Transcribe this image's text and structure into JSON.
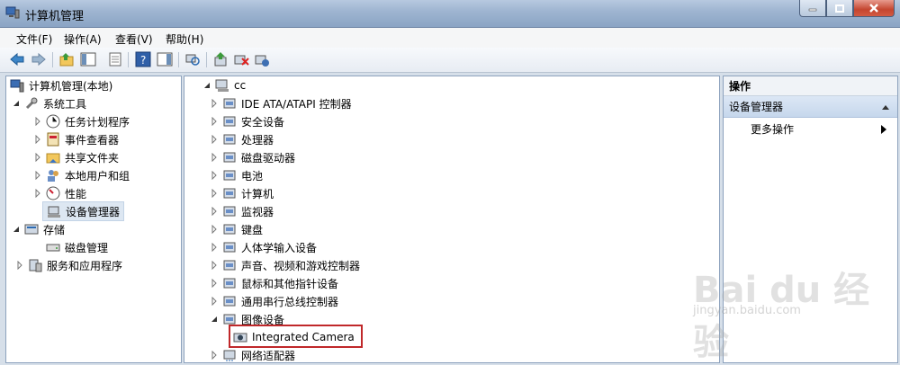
{
  "window": {
    "title": "计算机管理"
  },
  "menu": [
    "文件(F)",
    "操作(A)",
    "查看(V)",
    "帮助(H)"
  ],
  "toolbar_icons": [
    "back-icon",
    "forward-icon",
    "up-folder-icon",
    "show-hide-tree-icon",
    "export-list-icon",
    "help-icon",
    "show-hide-action-pane-icon",
    "scan-hardware-icon",
    "update-driver-icon",
    "disable-device-icon",
    "uninstall-device-icon"
  ],
  "left_tree": {
    "root": "计算机管理(本地)",
    "system_tools": "系统工具",
    "items": [
      "任务计划程序",
      "事件查看器",
      "共享文件夹",
      "本地用户和组",
      "性能",
      "设备管理器"
    ],
    "storage": "存储",
    "disk_mgmt": "磁盘管理",
    "services": "服务和应用程序"
  },
  "device_tree": {
    "computer_name": "cc",
    "categories": [
      "IDE ATA/ATAPI 控制器",
      "安全设备",
      "处理器",
      "磁盘驱动器",
      "电池",
      "计算机",
      "监视器",
      "键盘",
      "人体学输入设备",
      "声音、视频和游戏控制器",
      "鼠标和其他指针设备",
      "通用串行总线控制器",
      "图像设备"
    ],
    "child": "Integrated Camera",
    "last": "网络适配器"
  },
  "actions": {
    "header": "操作",
    "group": "设备管理器",
    "more": "更多操作"
  },
  "watermark": {
    "logo": "Bai du 经验",
    "url": "jingyan.baidu.com"
  }
}
